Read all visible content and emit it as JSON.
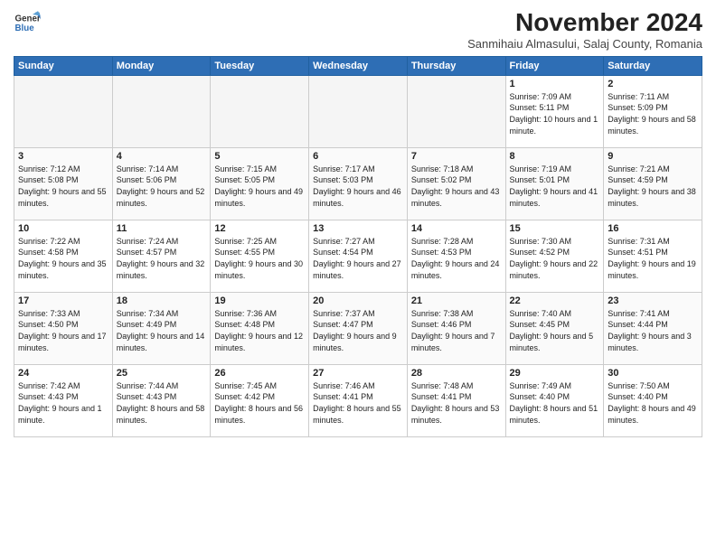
{
  "header": {
    "logo_line1": "General",
    "logo_line2": "Blue",
    "month_title": "November 2024",
    "subtitle": "Sanmihaiu Almasului, Salaj County, Romania"
  },
  "days_of_week": [
    "Sunday",
    "Monday",
    "Tuesday",
    "Wednesday",
    "Thursday",
    "Friday",
    "Saturday"
  ],
  "weeks": [
    [
      {
        "day": "",
        "empty": true
      },
      {
        "day": "",
        "empty": true
      },
      {
        "day": "",
        "empty": true
      },
      {
        "day": "",
        "empty": true
      },
      {
        "day": "",
        "empty": true
      },
      {
        "day": "1",
        "sunrise": "Sunrise: 7:09 AM",
        "sunset": "Sunset: 5:11 PM",
        "daylight": "Daylight: 10 hours and 1 minute."
      },
      {
        "day": "2",
        "sunrise": "Sunrise: 7:11 AM",
        "sunset": "Sunset: 5:09 PM",
        "daylight": "Daylight: 9 hours and 58 minutes."
      }
    ],
    [
      {
        "day": "3",
        "sunrise": "Sunrise: 7:12 AM",
        "sunset": "Sunset: 5:08 PM",
        "daylight": "Daylight: 9 hours and 55 minutes."
      },
      {
        "day": "4",
        "sunrise": "Sunrise: 7:14 AM",
        "sunset": "Sunset: 5:06 PM",
        "daylight": "Daylight: 9 hours and 52 minutes."
      },
      {
        "day": "5",
        "sunrise": "Sunrise: 7:15 AM",
        "sunset": "Sunset: 5:05 PM",
        "daylight": "Daylight: 9 hours and 49 minutes."
      },
      {
        "day": "6",
        "sunrise": "Sunrise: 7:17 AM",
        "sunset": "Sunset: 5:03 PM",
        "daylight": "Daylight: 9 hours and 46 minutes."
      },
      {
        "day": "7",
        "sunrise": "Sunrise: 7:18 AM",
        "sunset": "Sunset: 5:02 PM",
        "daylight": "Daylight: 9 hours and 43 minutes."
      },
      {
        "day": "8",
        "sunrise": "Sunrise: 7:19 AM",
        "sunset": "Sunset: 5:01 PM",
        "daylight": "Daylight: 9 hours and 41 minutes."
      },
      {
        "day": "9",
        "sunrise": "Sunrise: 7:21 AM",
        "sunset": "Sunset: 4:59 PM",
        "daylight": "Daylight: 9 hours and 38 minutes."
      }
    ],
    [
      {
        "day": "10",
        "sunrise": "Sunrise: 7:22 AM",
        "sunset": "Sunset: 4:58 PM",
        "daylight": "Daylight: 9 hours and 35 minutes."
      },
      {
        "day": "11",
        "sunrise": "Sunrise: 7:24 AM",
        "sunset": "Sunset: 4:57 PM",
        "daylight": "Daylight: 9 hours and 32 minutes."
      },
      {
        "day": "12",
        "sunrise": "Sunrise: 7:25 AM",
        "sunset": "Sunset: 4:55 PM",
        "daylight": "Daylight: 9 hours and 30 minutes."
      },
      {
        "day": "13",
        "sunrise": "Sunrise: 7:27 AM",
        "sunset": "Sunset: 4:54 PM",
        "daylight": "Daylight: 9 hours and 27 minutes."
      },
      {
        "day": "14",
        "sunrise": "Sunrise: 7:28 AM",
        "sunset": "Sunset: 4:53 PM",
        "daylight": "Daylight: 9 hours and 24 minutes."
      },
      {
        "day": "15",
        "sunrise": "Sunrise: 7:30 AM",
        "sunset": "Sunset: 4:52 PM",
        "daylight": "Daylight: 9 hours and 22 minutes."
      },
      {
        "day": "16",
        "sunrise": "Sunrise: 7:31 AM",
        "sunset": "Sunset: 4:51 PM",
        "daylight": "Daylight: 9 hours and 19 minutes."
      }
    ],
    [
      {
        "day": "17",
        "sunrise": "Sunrise: 7:33 AM",
        "sunset": "Sunset: 4:50 PM",
        "daylight": "Daylight: 9 hours and 17 minutes."
      },
      {
        "day": "18",
        "sunrise": "Sunrise: 7:34 AM",
        "sunset": "Sunset: 4:49 PM",
        "daylight": "Daylight: 9 hours and 14 minutes."
      },
      {
        "day": "19",
        "sunrise": "Sunrise: 7:36 AM",
        "sunset": "Sunset: 4:48 PM",
        "daylight": "Daylight: 9 hours and 12 minutes."
      },
      {
        "day": "20",
        "sunrise": "Sunrise: 7:37 AM",
        "sunset": "Sunset: 4:47 PM",
        "daylight": "Daylight: 9 hours and 9 minutes."
      },
      {
        "day": "21",
        "sunrise": "Sunrise: 7:38 AM",
        "sunset": "Sunset: 4:46 PM",
        "daylight": "Daylight: 9 hours and 7 minutes."
      },
      {
        "day": "22",
        "sunrise": "Sunrise: 7:40 AM",
        "sunset": "Sunset: 4:45 PM",
        "daylight": "Daylight: 9 hours and 5 minutes."
      },
      {
        "day": "23",
        "sunrise": "Sunrise: 7:41 AM",
        "sunset": "Sunset: 4:44 PM",
        "daylight": "Daylight: 9 hours and 3 minutes."
      }
    ],
    [
      {
        "day": "24",
        "sunrise": "Sunrise: 7:42 AM",
        "sunset": "Sunset: 4:43 PM",
        "daylight": "Daylight: 9 hours and 1 minute."
      },
      {
        "day": "25",
        "sunrise": "Sunrise: 7:44 AM",
        "sunset": "Sunset: 4:43 PM",
        "daylight": "Daylight: 8 hours and 58 minutes."
      },
      {
        "day": "26",
        "sunrise": "Sunrise: 7:45 AM",
        "sunset": "Sunset: 4:42 PM",
        "daylight": "Daylight: 8 hours and 56 minutes."
      },
      {
        "day": "27",
        "sunrise": "Sunrise: 7:46 AM",
        "sunset": "Sunset: 4:41 PM",
        "daylight": "Daylight: 8 hours and 55 minutes."
      },
      {
        "day": "28",
        "sunrise": "Sunrise: 7:48 AM",
        "sunset": "Sunset: 4:41 PM",
        "daylight": "Daylight: 8 hours and 53 minutes."
      },
      {
        "day": "29",
        "sunrise": "Sunrise: 7:49 AM",
        "sunset": "Sunset: 4:40 PM",
        "daylight": "Daylight: 8 hours and 51 minutes."
      },
      {
        "day": "30",
        "sunrise": "Sunrise: 7:50 AM",
        "sunset": "Sunset: 4:40 PM",
        "daylight": "Daylight: 8 hours and 49 minutes."
      }
    ]
  ]
}
